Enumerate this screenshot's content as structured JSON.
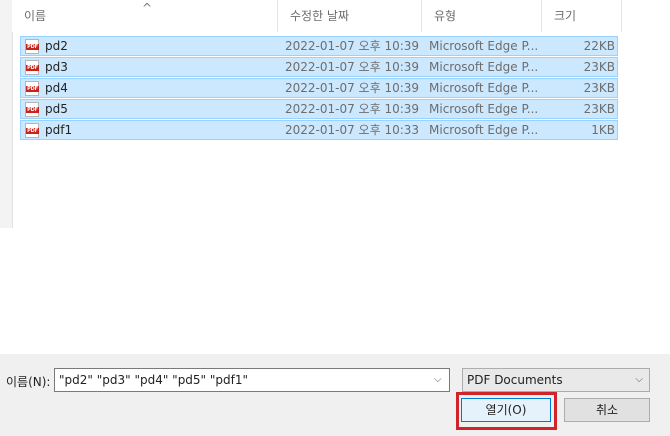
{
  "columns": {
    "name": "이름",
    "modified": "수정한 날짜",
    "type": "유형",
    "size": "크기"
  },
  "files": [
    {
      "name": "pd2",
      "modified": "2022-01-07 오후 10:39",
      "type": "Microsoft Edge P...",
      "size": "22KB"
    },
    {
      "name": "pd3",
      "modified": "2022-01-07 오후 10:39",
      "type": "Microsoft Edge P...",
      "size": "23KB"
    },
    {
      "name": "pd4",
      "modified": "2022-01-07 오후 10:39",
      "type": "Microsoft Edge P...",
      "size": "23KB"
    },
    {
      "name": "pd5",
      "modified": "2022-01-07 오후 10:39",
      "type": "Microsoft Edge P...",
      "size": "23KB"
    },
    {
      "name": "pdf1",
      "modified": "2022-01-07 오후 10:33",
      "type": "Microsoft Edge P...",
      "size": "1KB"
    }
  ],
  "icon_label": "PDF",
  "bottom": {
    "name_label": "이름(N):",
    "name_value": "\"pd2\" \"pd3\" \"pd4\" \"pd5\" \"pdf1\"",
    "file_type": "PDF Documents",
    "open_label": "열기(O)",
    "cancel_label": "취소"
  },
  "colors": {
    "selection_bg": "#cce8ff",
    "selection_border": "#99d1ff",
    "highlight_box": "#d0232a",
    "pdf_red": "#c9221b"
  }
}
